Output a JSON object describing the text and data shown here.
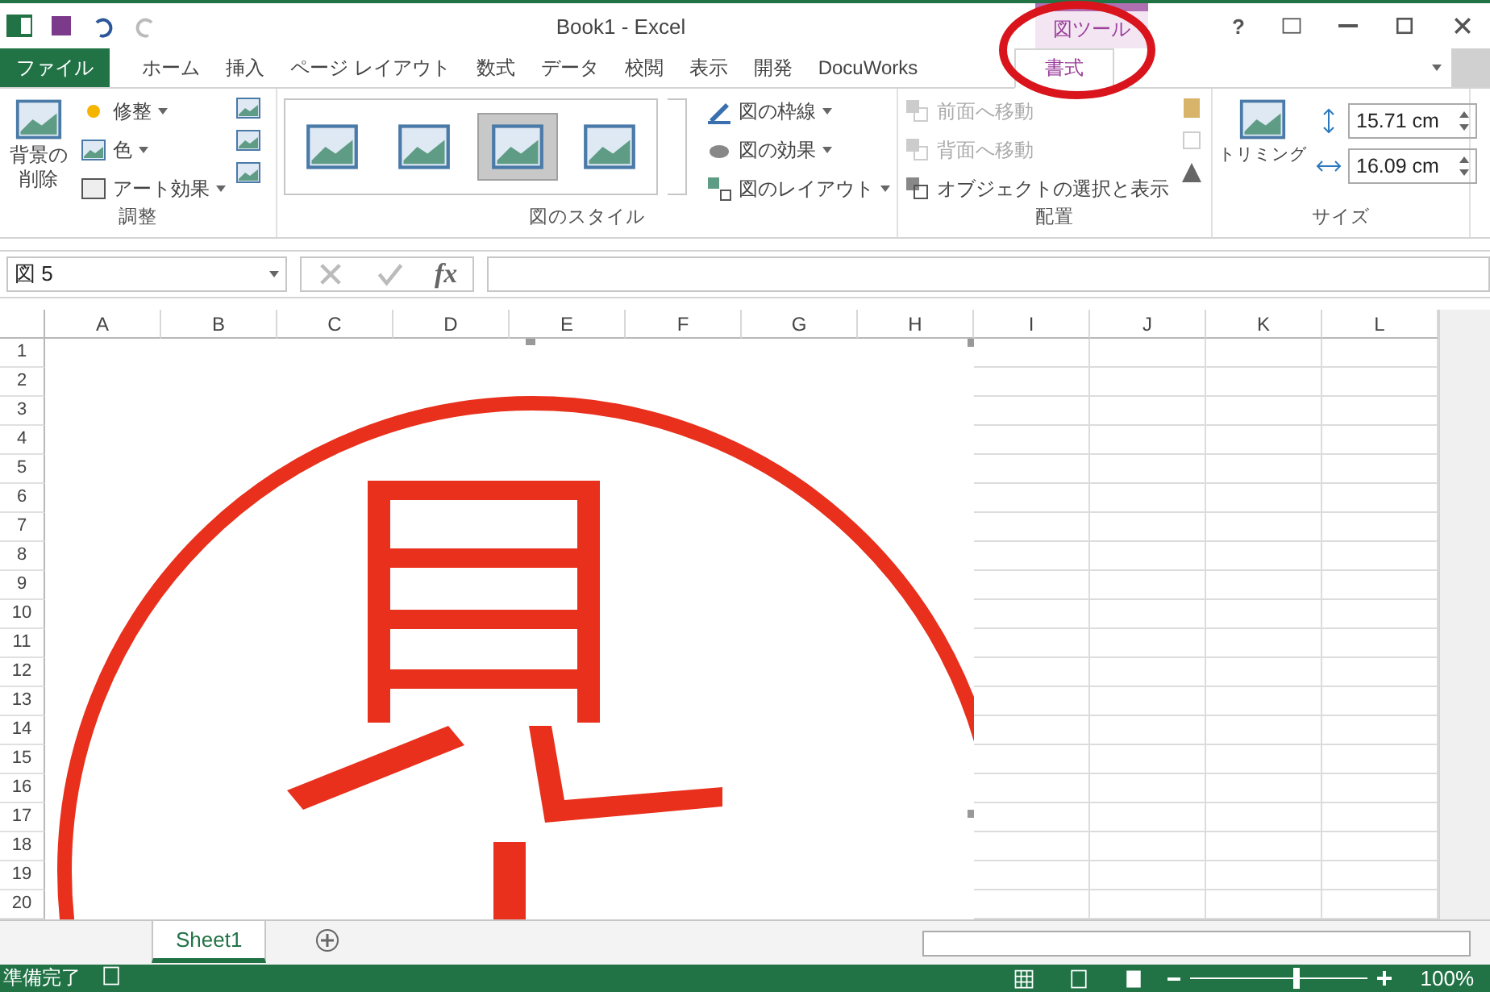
{
  "title_bar": {
    "title": "Book1 - Excel",
    "context_label": "図ツール",
    "help": "?"
  },
  "tabs": [
    {
      "label": "ファイル",
      "kind": "file",
      "selected": false
    },
    {
      "label": "ホーム",
      "kind": "tab",
      "selected": false
    },
    {
      "label": "挿入",
      "kind": "tab",
      "selected": false
    },
    {
      "label": "ページ レイアウト",
      "kind": "tab",
      "selected": false
    },
    {
      "label": "数式",
      "kind": "tab",
      "selected": false
    },
    {
      "label": "データ",
      "kind": "tab",
      "selected": false
    },
    {
      "label": "校閲",
      "kind": "tab",
      "selected": false
    },
    {
      "label": "表示",
      "kind": "tab",
      "selected": false
    },
    {
      "label": "開発",
      "kind": "tab",
      "selected": false
    },
    {
      "label": "DocuWorks",
      "kind": "tab",
      "selected": false
    },
    {
      "label": "書式",
      "kind": "context",
      "selected": true
    }
  ],
  "ribbon": {
    "adjust": {
      "label": "調整",
      "remove_background": [
        "背景の",
        "削除"
      ],
      "items": [
        {
          "label": "修整"
        },
        {
          "label": "色"
        },
        {
          "label": "アート効果"
        }
      ]
    },
    "styles": {
      "label": "図のスタイル",
      "gallery": [
        {
          "selected": false
        },
        {
          "selected": false
        },
        {
          "selected": true
        },
        {
          "selected": false
        }
      ],
      "items": [
        {
          "label": "図の枠線"
        },
        {
          "label": "図の効果"
        },
        {
          "label": "図のレイアウト"
        }
      ]
    },
    "arrange": {
      "label": "配置",
      "items": [
        {
          "label": "前面へ移動",
          "disabled": true
        },
        {
          "label": "背面へ移動",
          "disabled": true
        },
        {
          "label": "オブジェクトの選択と表示",
          "disabled": false
        }
      ]
    },
    "size": {
      "label": "サイズ",
      "crop": "トリミング",
      "height": "15.71 cm",
      "width": "16.09 cm"
    }
  },
  "formula_bar": {
    "name_box": "図 5",
    "fx": "fx"
  },
  "columns": [
    "A",
    "B",
    "C",
    "D",
    "E",
    "F",
    "G",
    "H",
    "I",
    "J",
    "K",
    "L"
  ],
  "rows": [
    "1",
    "2",
    "3",
    "4",
    "5",
    "6",
    "7",
    "8",
    "9",
    "10",
    "11",
    "12",
    "13",
    "14",
    "15",
    "16",
    "17",
    "18",
    "19",
    "20"
  ],
  "sheets": [
    {
      "label": "Sheet1",
      "selected": true
    }
  ],
  "status_bar": {
    "status": "準備完了",
    "zoom": "100%",
    "zoom_level": {
      "level": 0.6
    }
  }
}
